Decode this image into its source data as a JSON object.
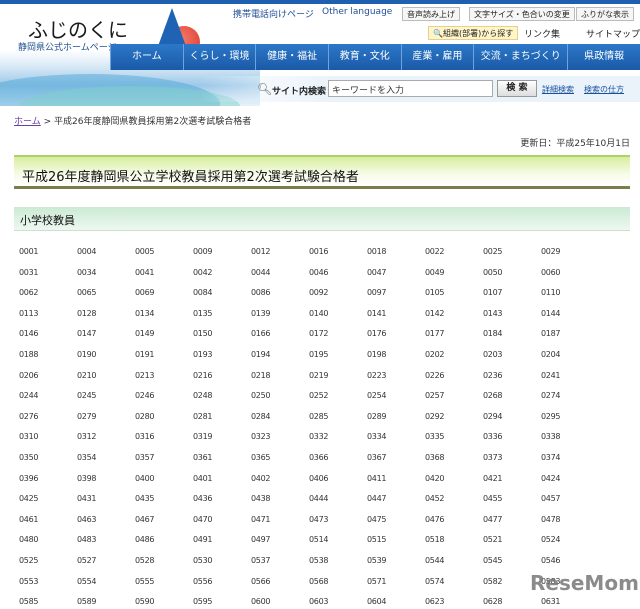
{
  "header": {
    "logo_title": "ふじのくに",
    "logo_subtitle": "静岡県公式ホームページ",
    "mobile_link": "携帯電話向けページ",
    "other_language": "Other language",
    "read_aloud": "音声読み上げ",
    "text_size_color": "文字サイズ・色合いの変更",
    "furigana": "ふりがな表示",
    "org_search": "組織(部署)から探す",
    "links": "リンク集",
    "sitemap": "サイトマップ"
  },
  "nav": [
    "ホーム",
    "くらし・環境",
    "健康・福祉",
    "教育・文化",
    "産業・雇用",
    "交流・まちづくり",
    "県政情報"
  ],
  "search": {
    "label": "サイト内検索",
    "placeholder": "キーワードを入力",
    "button": "検 索",
    "advanced": "詳細検索",
    "howto": "検索の仕方"
  },
  "breadcrumb": {
    "home": "ホーム",
    "separator": ">",
    "current": "平成26年度静岡県教員採用第2次選考試験合格者"
  },
  "updated": "更新日：平成25年10月1日",
  "page_title": "平成26年度静岡県公立学校教員採用第2次選考試験合格者",
  "section_title": "小学校教員",
  "numbers": [
    [
      "0001",
      "0004",
      "0005",
      "0009",
      "0012",
      "0016",
      "0018",
      "0022",
      "0025",
      "0029"
    ],
    [
      "0031",
      "0034",
      "0041",
      "0042",
      "0044",
      "0046",
      "0047",
      "0049",
      "0050",
      "0060"
    ],
    [
      "0062",
      "0065",
      "0069",
      "0084",
      "0086",
      "0092",
      "0097",
      "0105",
      "0107",
      "0110"
    ],
    [
      "0113",
      "0128",
      "0134",
      "0135",
      "0139",
      "0140",
      "0141",
      "0142",
      "0143",
      "0144"
    ],
    [
      "0146",
      "0147",
      "0149",
      "0150",
      "0166",
      "0172",
      "0176",
      "0177",
      "0184",
      "0187"
    ],
    [
      "0188",
      "0190",
      "0191",
      "0193",
      "0194",
      "0195",
      "0198",
      "0202",
      "0203",
      "0204"
    ],
    [
      "0206",
      "0210",
      "0213",
      "0216",
      "0218",
      "0219",
      "0223",
      "0226",
      "0236",
      "0241"
    ],
    [
      "0244",
      "0245",
      "0246",
      "0248",
      "0250",
      "0252",
      "0254",
      "0257",
      "0268",
      "0274"
    ],
    [
      "0276",
      "0279",
      "0280",
      "0281",
      "0284",
      "0285",
      "0289",
      "0292",
      "0294",
      "0295"
    ],
    [
      "0310",
      "0312",
      "0316",
      "0319",
      "0323",
      "0332",
      "0334",
      "0335",
      "0336",
      "0338"
    ],
    [
      "0350",
      "0354",
      "0357",
      "0361",
      "0365",
      "0366",
      "0367",
      "0368",
      "0373",
      "0374"
    ],
    [
      "0396",
      "0398",
      "0400",
      "0401",
      "0402",
      "0406",
      "0411",
      "0420",
      "0421",
      "0424"
    ],
    [
      "0425",
      "0431",
      "0435",
      "0436",
      "0438",
      "0444",
      "0447",
      "0452",
      "0455",
      "0457"
    ],
    [
      "0461",
      "0463",
      "0467",
      "0470",
      "0471",
      "0473",
      "0475",
      "0476",
      "0477",
      "0478"
    ],
    [
      "0480",
      "0483",
      "0486",
      "0491",
      "0497",
      "0514",
      "0515",
      "0518",
      "0521",
      "0524"
    ],
    [
      "0525",
      "0527",
      "0528",
      "0530",
      "0537",
      "0538",
      "0539",
      "0544",
      "0545",
      "0546"
    ],
    [
      "0553",
      "0554",
      "0555",
      "0556",
      "0566",
      "0568",
      "0571",
      "0574",
      "0582",
      "0583"
    ],
    [
      "0585",
      "0589",
      "0590",
      "0595",
      "0600",
      "0603",
      "0604",
      "0623",
      "0628",
      "0631"
    ]
  ],
  "watermark": "ReseMom"
}
